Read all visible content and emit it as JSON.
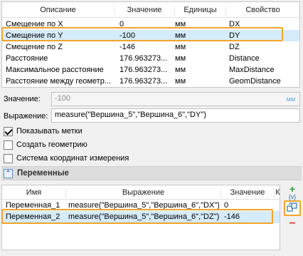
{
  "params_table": {
    "headers": [
      "Описание",
      "Значение",
      "Единицы",
      "Свойство"
    ],
    "rows": [
      {
        "desc": "Смещение по X",
        "value": "0",
        "units": "мм",
        "prop": "DX"
      },
      {
        "desc": "Смещение по Y",
        "value": "-100",
        "units": "мм",
        "prop": "DY"
      },
      {
        "desc": "Смещение по Z",
        "value": "-146",
        "units": "мм",
        "prop": "DZ"
      },
      {
        "desc": "Расстояние",
        "value": "176.963273...",
        "units": "мм",
        "prop": "Distance"
      },
      {
        "desc": "Максимальное расстояние",
        "value": "176.963273...",
        "units": "мм",
        "prop": "MaxDistance"
      },
      {
        "desc": "Расстояние между геометр...",
        "value": "176.963273...",
        "units": "мм",
        "prop": "GeomDistance"
      }
    ],
    "selected_index": 1
  },
  "value_field": {
    "label": "Значение:",
    "value": "-100",
    "unit": "мм"
  },
  "expression_field": {
    "label": "Выражение:",
    "value": "measure(\"Вершина_5\",\"Вершина_6\",\"DY\")"
  },
  "checkboxes": [
    {
      "label": "Показывать метки",
      "checked": true
    },
    {
      "label": "Создать геометрию",
      "checked": false
    },
    {
      "label": "Система координат измерения",
      "checked": false
    }
  ],
  "variables_section": {
    "title": "Переменные",
    "toggle": "⌃"
  },
  "variables_table": {
    "headers": [
      "Имя",
      "Выражение",
      "Значение",
      "К"
    ],
    "rows": [
      {
        "name": "Переменная_1",
        "expr": "measure(\"Вершина_5\",\"Вершина_6\",\"DX\")",
        "value": "0"
      },
      {
        "name": "Переменная_2",
        "expr": "measure(\"Вершина_5\",\"Вершина_6\",\"DZ\")",
        "value": "-146"
      }
    ],
    "selected_index": 1
  },
  "side_buttons": {
    "add_icon": "+",
    "var_icon": "{v}",
    "minus_icon": "−"
  },
  "colors": {
    "highlight": "#f2a42d",
    "selection": "#d5ebfa",
    "accent": "#3a6ea5"
  }
}
